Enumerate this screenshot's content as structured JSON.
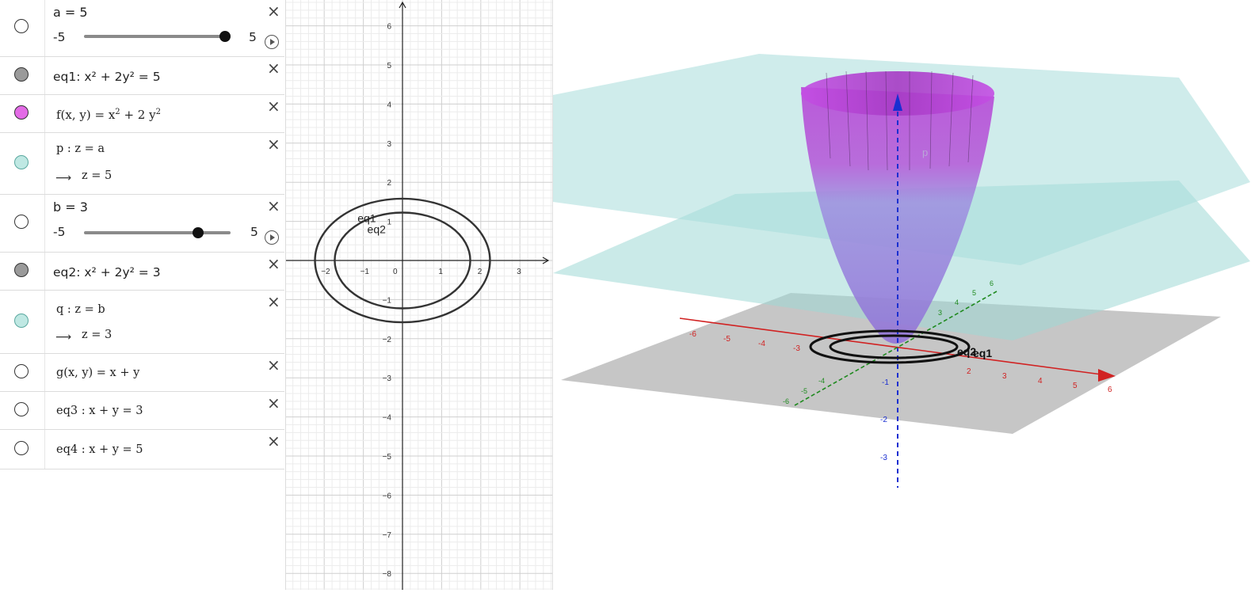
{
  "algebra": {
    "rows": [
      {
        "type": "slider",
        "name": "a = 5",
        "min": "-5",
        "max": "5",
        "value": 5,
        "color": "#ffffff"
      },
      {
        "type": "expr",
        "text": "eq1: x² + 2y² = 5",
        "color": "#9a9a9a"
      },
      {
        "type": "expr",
        "text_pre": "f(x, y)  = x",
        "sup1": "2",
        "text_mid": " + 2 y",
        "sup2": "2",
        "color": "#e36be6"
      },
      {
        "type": "expr2",
        "line1": "p : z = a",
        "line2": "z = 5",
        "color": "#bfe8e3"
      },
      {
        "type": "slider",
        "name": "b = 3",
        "min": "-5",
        "max": "5",
        "value": 3,
        "color": "#ffffff"
      },
      {
        "type": "expr",
        "text": "eq2: x² + 2y² = 3",
        "color": "#9a9a9a"
      },
      {
        "type": "expr2",
        "line1": "q : z = b",
        "line2": "z = 3",
        "color": "#bfe8e3"
      },
      {
        "type": "expr",
        "text": "g(x, y)  = x + y",
        "color": "#ffffff"
      },
      {
        "type": "expr",
        "text": "eq3 : x + y = 3",
        "color": "#ffffff"
      },
      {
        "type": "expr",
        "text": "eq4 : x + y = 5",
        "color": "#ffffff"
      }
    ],
    "close_glyph": "×",
    "arrow_glyph": "⟶"
  },
  "graph2d": {
    "x_ticks": [
      "−2",
      "−1",
      "0",
      "1",
      "2",
      "3"
    ],
    "y_ticks": [
      "6",
      "5",
      "4",
      "3",
      "2",
      "1",
      "−1",
      "−2",
      "−3",
      "−4",
      "−5",
      "−6",
      "−7",
      "−8"
    ],
    "curve_labels": [
      "eq1",
      "eq2"
    ],
    "xrange": [
      -2.5,
      3.6
    ],
    "yrange": [
      -8.2,
      6.6
    ]
  },
  "graph3d": {
    "x_ticks": [
      "-6",
      "-5",
      "-4",
      "-3",
      "2",
      "3",
      "4",
      "5",
      "6"
    ],
    "y_ticks": [
      "-6",
      "-5",
      "-4",
      "3",
      "4",
      "5",
      "6"
    ],
    "z_ticks": [
      "-1",
      "-2",
      "-3"
    ],
    "labels": [
      "eq2",
      "eq1",
      "p"
    ],
    "colors": {
      "surface": "#b84fd9",
      "plane": "#9fd8d6",
      "floor": "#b0b0b0",
      "xaxis": "#d12222",
      "yaxis": "#1f8a1f",
      "zaxis": "#1a2fd1"
    }
  }
}
